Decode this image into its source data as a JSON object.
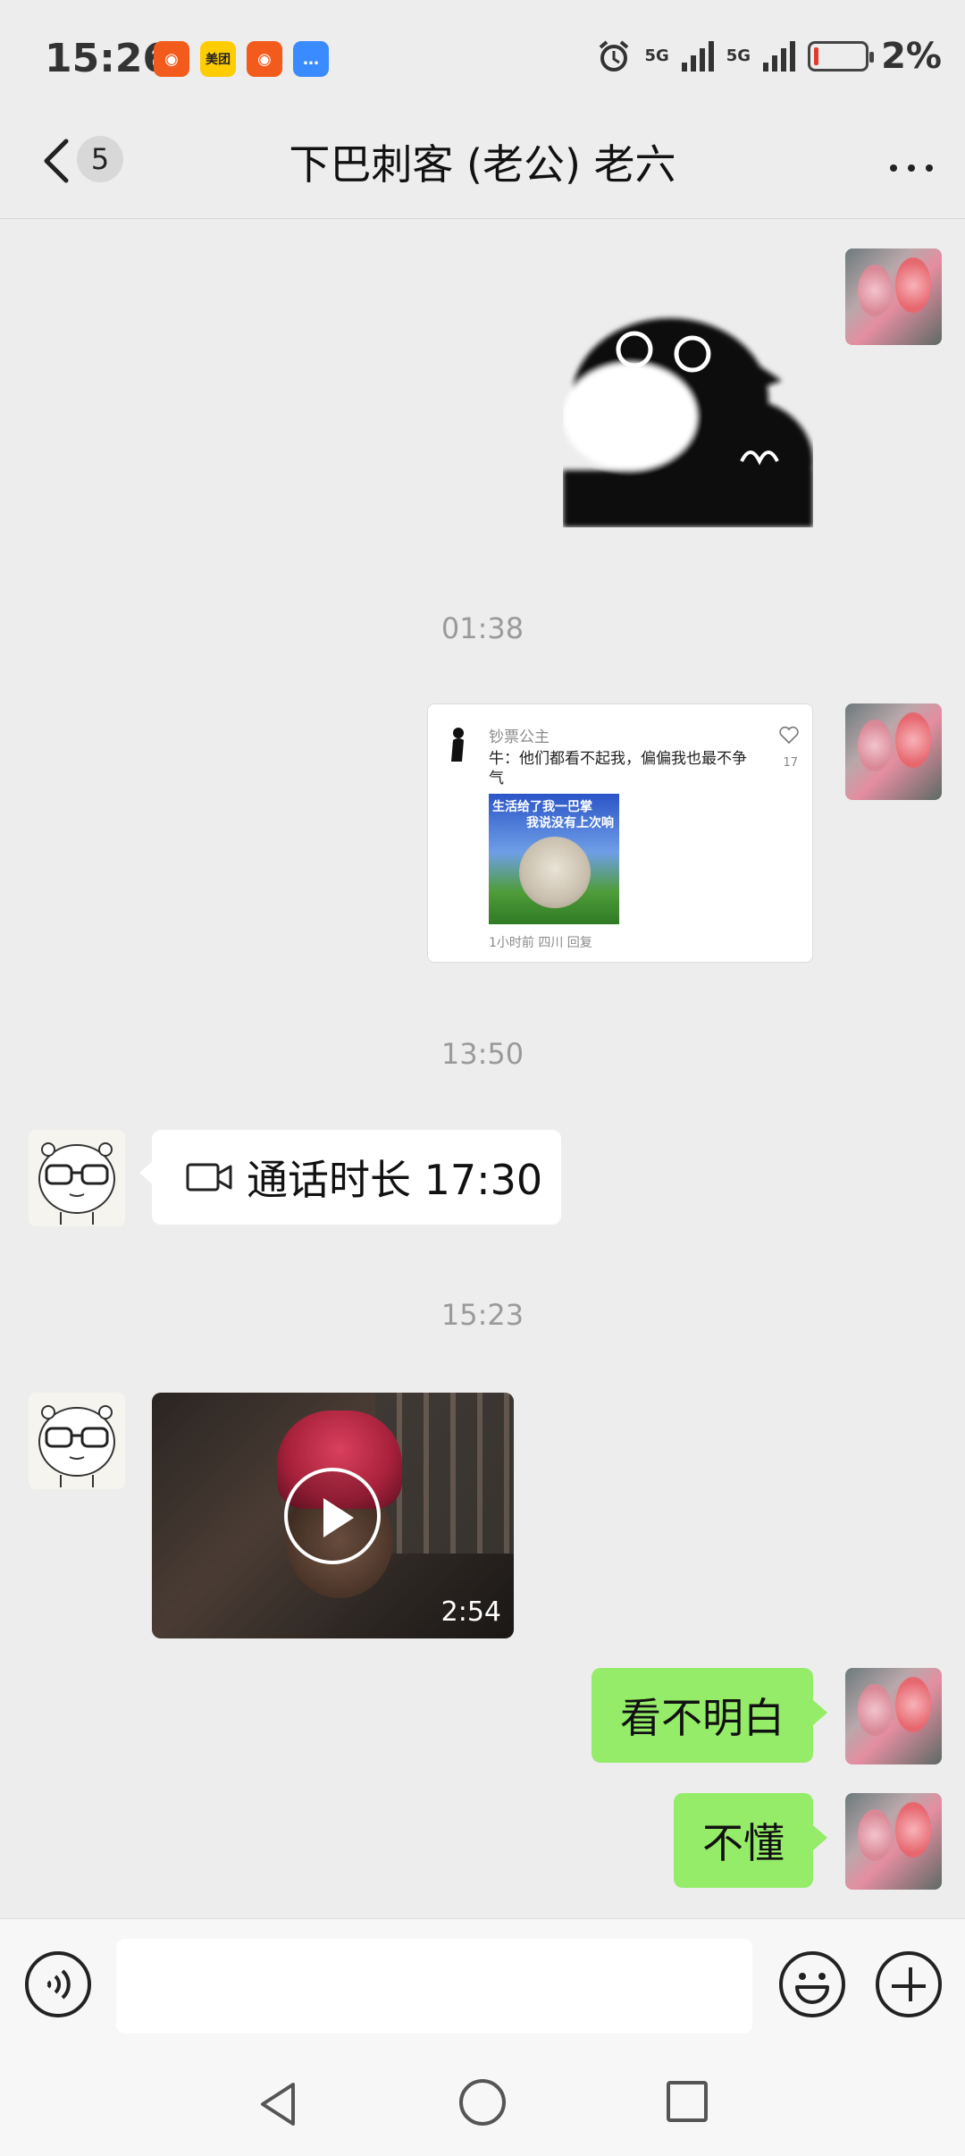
{
  "status_bar": {
    "time": "15:26",
    "notifications": [
      "kuaishou-icon",
      "meituan-icon",
      "kuaishou-icon",
      "message-icon"
    ],
    "meituan_label": "美团",
    "signal1": "5G",
    "signal2": "5G",
    "battery_percent": "2%",
    "battery_level": 0.02
  },
  "header": {
    "unread_count": "5",
    "title": "下巴刺客 (老公) 老六"
  },
  "messages": {
    "ts1": "01:38",
    "card": {
      "author": "钞票公主",
      "text": "牛：他们都看不起我，偏偏我也最不争气",
      "image_text1": "生活给了我一巴掌",
      "image_text2": "我说没有上次响",
      "meta": "1小时前 四川  回复",
      "likes": "17"
    },
    "ts2": "13:50",
    "call_text": "通话时长 17:30",
    "ts3": "15:23",
    "video_duration": "2:54",
    "msg1": "看不明白",
    "msg2": "不懂"
  },
  "colors": {
    "background": "#ededed",
    "my_bubble": "#95ec69",
    "other_bubble": "#ffffff"
  }
}
